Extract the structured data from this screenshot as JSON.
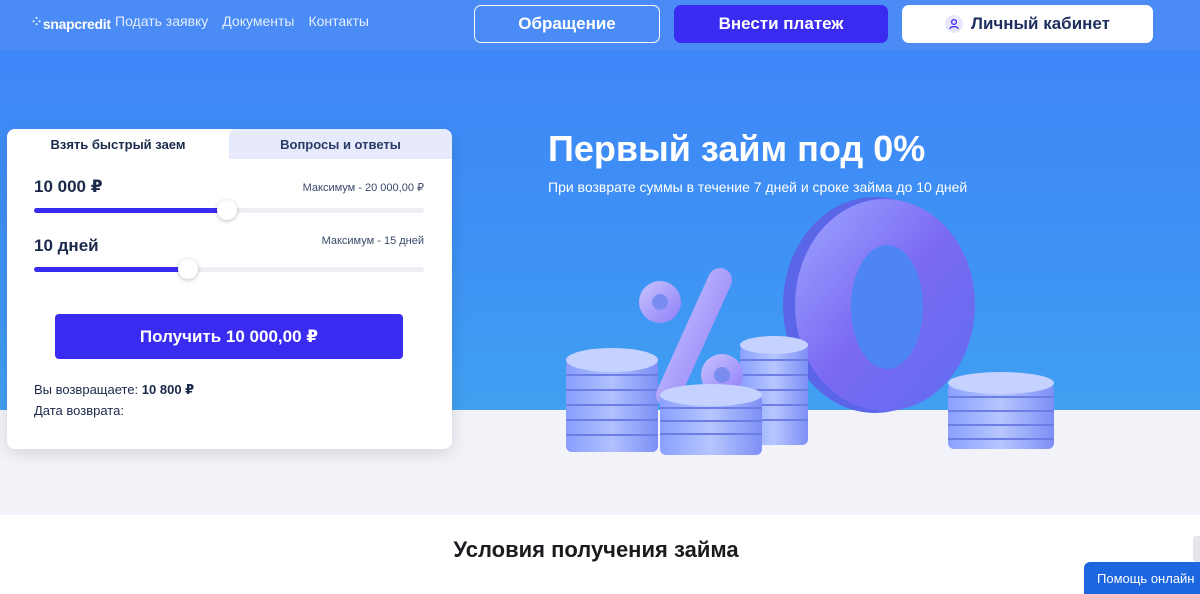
{
  "header": {
    "logo": "snapcredit",
    "nav": [
      "Подать заявку",
      "Документы",
      "Контакты"
    ],
    "appeal_button": "Обращение",
    "pay_button": "Внести платеж",
    "cabinet_button": "Личный кабинет"
  },
  "hero": {
    "title": "Первый займ под 0%",
    "subtitle": "При возврате суммы в течение 7 дней и сроке займа до 10 дней",
    "art_big_digit": "0",
    "art_percent": "%"
  },
  "calculator": {
    "tabs": [
      "Взять быстрый заем",
      "Вопросы и ответы"
    ],
    "active_tab": 0,
    "amount": {
      "value_label": "10 000 ₽",
      "max_label": "Максимум - 20 000,00 ₽",
      "fill_fraction": 0.495
    },
    "term": {
      "value_label": "10 дней",
      "max_label": "Максимум - 15 дней",
      "fill_fraction": 0.395
    },
    "submit_button": "Получить 10 000,00 ₽",
    "return_label": "Вы возвращаете:",
    "return_value": "10 800 ₽",
    "return_date_label": "Дата возврата:"
  },
  "section": {
    "title": "Условия получения займа"
  },
  "help_widget": {
    "label": "Помощь онлайн"
  },
  "colors": {
    "hero_blue": "#3f86f8",
    "accent": "#3a2bf0",
    "lower_bg": "#f1f3f8",
    "help_blue": "#1c66e0"
  },
  "icons": {
    "cabinet": "user-icon",
    "logo": "spark-icon"
  }
}
